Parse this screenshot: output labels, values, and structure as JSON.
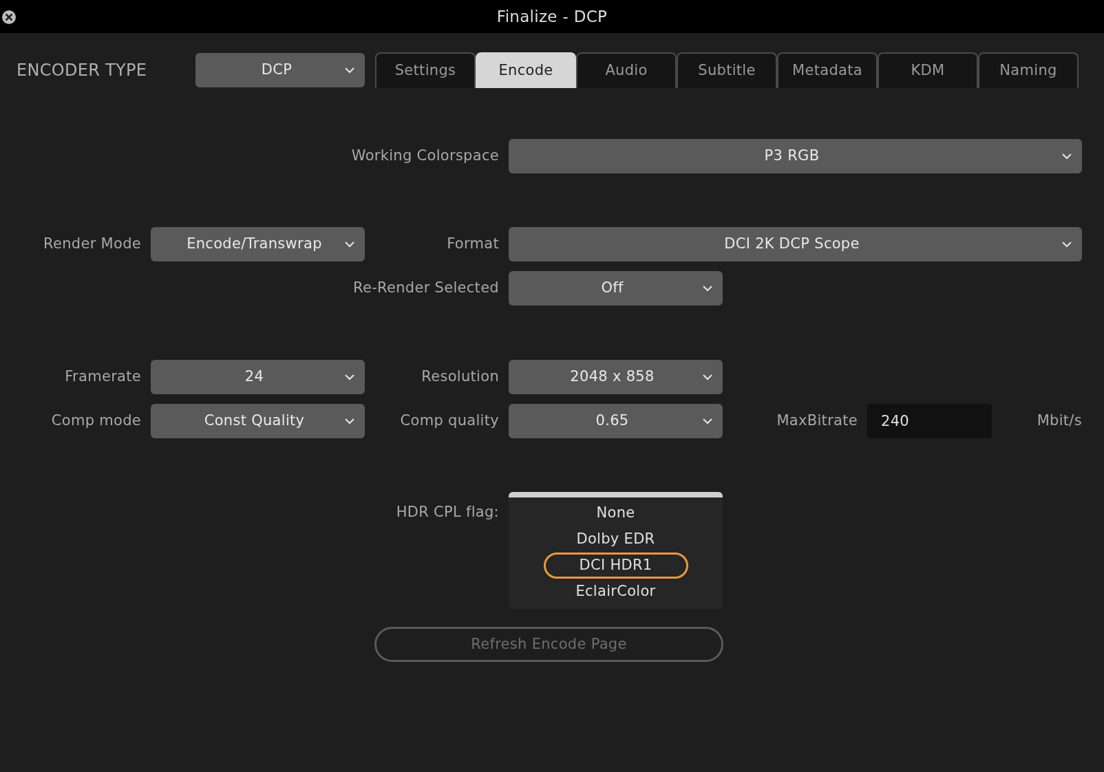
{
  "window": {
    "title": "Finalize - DCP"
  },
  "encoder_type": {
    "label": "ENCODER TYPE",
    "value": "DCP"
  },
  "tabs": [
    {
      "label": "Settings",
      "selected": false
    },
    {
      "label": "Encode",
      "selected": true
    },
    {
      "label": "Audio",
      "selected": false
    },
    {
      "label": "Subtitle",
      "selected": false
    },
    {
      "label": "Metadata",
      "selected": false
    },
    {
      "label": "KDM",
      "selected": false
    },
    {
      "label": "Naming",
      "selected": false
    }
  ],
  "working_colorspace": {
    "label": "Working Colorspace",
    "value": "P3 RGB"
  },
  "render_mode": {
    "label": "Render Mode",
    "value": "Encode/Transwrap"
  },
  "format": {
    "label": "Format",
    "value": "DCI 2K DCP Scope"
  },
  "re_render_selected": {
    "label": "Re-Render Selected",
    "value": "Off"
  },
  "framerate": {
    "label": "Framerate",
    "value": "24"
  },
  "resolution": {
    "label": "Resolution",
    "value": "2048 x 858"
  },
  "comp_mode": {
    "label": "Comp mode",
    "value": "Const Quality"
  },
  "comp_quality": {
    "label": "Comp quality",
    "value": "0.65"
  },
  "max_bitrate": {
    "label": "MaxBitrate",
    "value": "240",
    "unit": "Mbit/s"
  },
  "hdr_cpl_flag": {
    "label": "HDR CPL flag:",
    "options": [
      {
        "label": "None",
        "selected": false
      },
      {
        "label": "Dolby EDR",
        "selected": false
      },
      {
        "label": "DCI HDR1",
        "selected": true
      },
      {
        "label": "EclairColor",
        "selected": false
      }
    ]
  },
  "refresh_button": {
    "label": "Refresh Encode Page"
  }
}
